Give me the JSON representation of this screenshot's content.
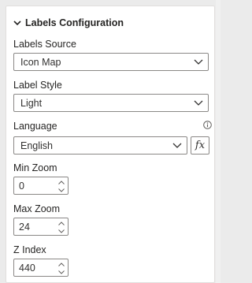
{
  "section": {
    "title": "Labels Configuration",
    "icon": "chevron-down-icon"
  },
  "labels_source": {
    "label": "Labels Source",
    "value": "Icon Map"
  },
  "label_style": {
    "label": "Label Style",
    "value": "Light"
  },
  "language": {
    "label": "Language",
    "value": "English",
    "fx_label": "fx",
    "info_icon": "info-icon"
  },
  "min_zoom": {
    "label": "Min Zoom",
    "value": "0"
  },
  "max_zoom": {
    "label": "Max Zoom",
    "value": "24"
  },
  "z_index": {
    "label": "Z Index",
    "value": "440"
  },
  "colors": {
    "text": "#252423",
    "border": "#8a8886",
    "panel_bg": "#ffffff",
    "page_bg": "#ebebeb"
  }
}
